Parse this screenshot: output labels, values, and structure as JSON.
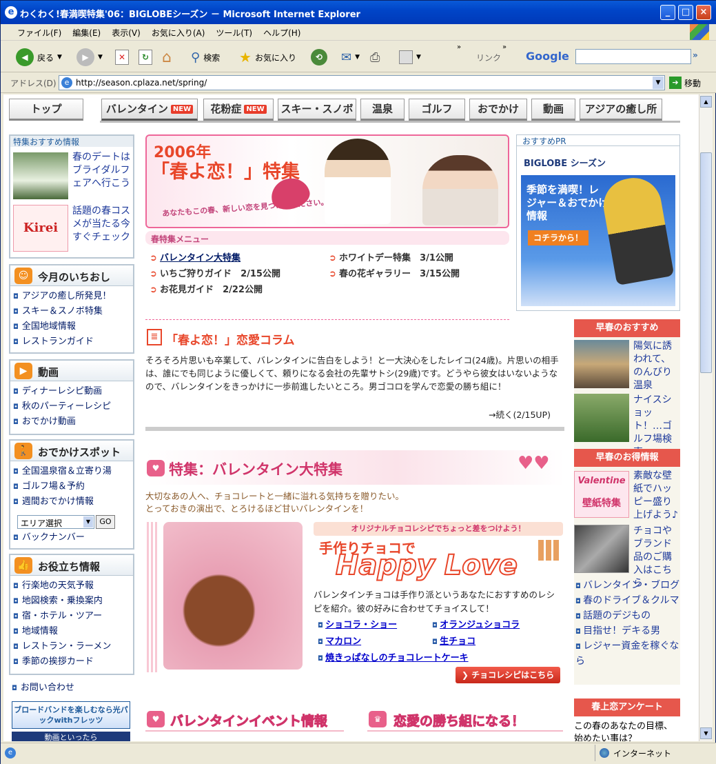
{
  "window": {
    "title": "わくわく!春満喫特集'06：BIGLOBEシーズン － Microsoft Internet Explorer"
  },
  "menu": [
    "ファイル(F)",
    "編集(E)",
    "表示(V)",
    "お気に入り(A)",
    "ツール(T)",
    "ヘルプ(H)"
  ],
  "toolbar": {
    "back": "戻る",
    "search": "検索",
    "favorites": "お気に入り",
    "links": "リンク",
    "google": "Google"
  },
  "address": {
    "label": "アドレス(D)",
    "url": "http://season.cplaza.net/spring/",
    "go": "移動"
  },
  "tabs": [
    {
      "label": "トップ",
      "new": ""
    },
    {
      "label": "バレンタイン",
      "new": "NEW"
    },
    {
      "label": "花粉症",
      "new": "NEW"
    },
    {
      "label": "スキー・スノボ",
      "new": ""
    },
    {
      "label": "温泉",
      "new": ""
    },
    {
      "label": "ゴルフ",
      "new": ""
    },
    {
      "label": "おでかけ",
      "new": ""
    },
    {
      "label": "動画",
      "new": ""
    },
    {
      "label": "アジアの癒し所",
      "new": ""
    }
  ],
  "left": {
    "recommend_title": "特集おすすめ情報",
    "rec1": "春のデートはブライダルフェアへ行こう",
    "rec2": "話題の春コスメが当たる今すぐチェック",
    "rec2_img": "Kirei",
    "ichioshi": {
      "title": "今月のいちおし",
      "items": [
        "アジアの癒し所発見！",
        "スキー＆スノボ特集",
        "全国地域情報",
        "レストランガイド"
      ]
    },
    "douga": {
      "title": "動画",
      "items": [
        "ディナーレシピ動画",
        "秋のパーティーレシピ",
        "おでかけ動画"
      ]
    },
    "spot": {
      "title": "おでかけスポット",
      "items": [
        "全国温泉宿＆立寄り湯",
        "ゴルフ場＆予約",
        "週間おでかけ情報"
      ],
      "select": "エリア選択",
      "go": "GO",
      "back": "バックナンバー"
    },
    "yakudachi": {
      "title": "お役立ち情報",
      "items": [
        "行楽地の天気予報",
        "地図検索・乗換案内",
        "宿・ホテル・ツアー",
        "地域情報",
        "レストラン・ラーメン",
        "季節の挨拶カード"
      ]
    },
    "contact": "お問い合わせ",
    "banner": "ブロードバンドを楽しむなら光パックwithフレッツ",
    "banner2": "動画といったら"
  },
  "center": {
    "hero_year": "2006年",
    "hero_title": "「春よ恋！」特集",
    "hero_sub": "あなたもこの春、新しい恋を見つけてください。",
    "menu_title": "春特集メニュー",
    "menu_items": [
      {
        "label": "バレンタイン大特集",
        "date": ""
      },
      {
        "label": "ホワイトデー特集",
        "date": "3/1公開"
      },
      {
        "label": "いちご狩りガイド",
        "date": "2/15公開"
      },
      {
        "label": "春の花ギャラリー",
        "date": "3/15公開"
      },
      {
        "label": "お花見ガイド",
        "date": "2/22公開"
      }
    ],
    "column_title": "「春よ恋！」恋愛コラム",
    "column_text": "そろそろ片思いも卒業して、バレンタインに告白をしよう！と一大決心をしたレイコ(24歳)。片思いの相手は、誰にでも同じように優しくて、頼りになる会社の先輩サトシ(29歳)です。どうやら彼女はいないようなので、バレンタインをきっかけに一歩前進したいところ。男ゴコロを学んで恋愛の勝ち組に！",
    "column_more": "→続く(2/15UP)",
    "val_title": "特集：バレンタイン大特集",
    "val_text1": "大切なあの人へ、チョコレートと一緒に溢れる気持ちを贈りたい。",
    "val_text2": "とっておきの演出で、とろけるほど甘いバレンタインを！",
    "recipe_ribbon": "オリジナルチョコレシピでちょっと差をつけよう！",
    "recipe_title1": "手作りチョコで",
    "recipe_title2": "Happy Love",
    "recipe_text": "バレンタインチョコは手作り派というあなたにおすすめのレシピを紹介。彼の好みに合わせてチョイスして！",
    "recipes": [
      "ショコラ・ショー",
      "オランジュショコラ",
      "マカロン",
      "生チョコ",
      "焼きっぱなしのチョコレートケーキ"
    ],
    "recipe_btn": "チョコレシピはこちら",
    "event_title": "バレンタインイベント情報",
    "win_title": "恋愛の勝ち組になる！"
  },
  "right": {
    "pr_label": "おすすめPR",
    "pr_brand": "BIGLOBE シーズン",
    "pr_text": "季節を満喫！レジャー＆おでかけ情報",
    "pr_btn": "コチラから！",
    "osusume_title": "早春のおすすめ",
    "item1": "陽気に誘われて、のんびり温泉",
    "item2": "ナイスショット！…ゴルフ場検索",
    "otoku_title": "早春のお得情報",
    "item3": "素敵な壁紙でハッピー盛り上げよう♪",
    "item3_img1": "Valentine",
    "item3_img2": "壁紙特集",
    "item4": "チョコやブランド品のご購入はこちら",
    "links": [
      "バレンタイン・ブログ",
      "春のドライブ＆クルマ",
      "話題のデジもの",
      "目指せ！デキる男",
      "レジャー資金を稼ぐなら"
    ],
    "survey_title": "春上恋アンケート",
    "survey_text": "この春のあなたの目標、始めたい事は？"
  },
  "status": {
    "zone": "インターネット"
  },
  "colors": {
    "accent": "#e8462a",
    "link": "#0000cc",
    "titlebar": "#0a5ad8"
  }
}
